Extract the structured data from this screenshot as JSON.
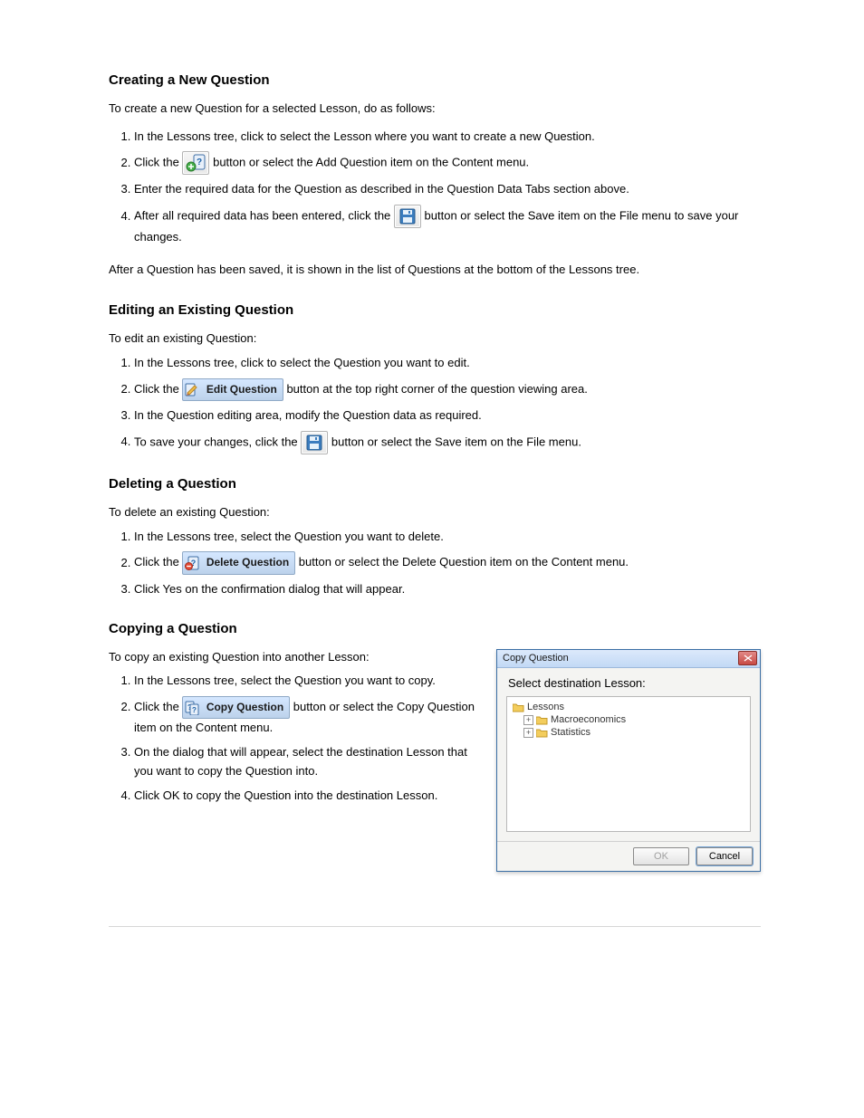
{
  "sections": {
    "create": {
      "title": "Creating a New Question",
      "intro": "To create a new Question for a selected Lesson, do as follows:",
      "steps": {
        "s1a": "In the Lessons tree, click to select the Lesson where you want to create a new Question.",
        "s2a": "Click the ",
        "s2b": " button or select the Add Question item on the Content menu.",
        "s3a": "Enter the required data for the Question as described in the Question Data Tabs section above.",
        "s4a": "After all required data has been entered, click the ",
        "s4b": " button or select the Save item on the File menu to save your changes."
      },
      "note": "After a Question has been saved, it is shown in the list of Questions at the bottom of the Lessons tree."
    },
    "edit": {
      "title": "Editing an Existing Question",
      "intro": "To edit an existing Question:",
      "steps": {
        "s1": "In the Lessons tree, click to select the Question you want to edit.",
        "s2a": "Click the ",
        "s2b": " button at the top right corner of the question viewing area.",
        "s3": "In the Question editing area, modify the Question data as required.",
        "s4a": "To save your changes, click the ",
        "s4b": " button or select the Save item on the File menu."
      }
    },
    "delete": {
      "title": "Deleting a Question",
      "intro": "To delete an existing Question:",
      "steps": {
        "s1": "In the Lessons tree, select the Question you want to delete.",
        "s2a": "Click the ",
        "s2b": " button or select the Delete Question item on the Content menu.",
        "s3": "Click Yes on the confirmation dialog that will appear."
      }
    },
    "copy": {
      "title": "Copying a Question",
      "intro": "To copy an existing Question into another Lesson:",
      "steps": {
        "s1": "In the Lessons tree, select the Question you want to copy.",
        "s2a": "Click the ",
        "s2b": " button or select the Copy Question item on the Content menu.",
        "s3": "On the dialog that will appear, select the destination Lesson that you want to copy the Question into.",
        "s4": "Click OK to copy the Question into the destination Lesson."
      }
    }
  },
  "buttons": {
    "edit_question": "Edit Question",
    "delete_question": "Delete Question",
    "copy_question": "Copy Question"
  },
  "dialog": {
    "title": "Copy Question",
    "prompt": "Select destination Lesson:",
    "root": "Lessons",
    "items": [
      "Macroeconomics",
      "Statistics"
    ],
    "ok": "OK",
    "cancel": "Cancel"
  }
}
